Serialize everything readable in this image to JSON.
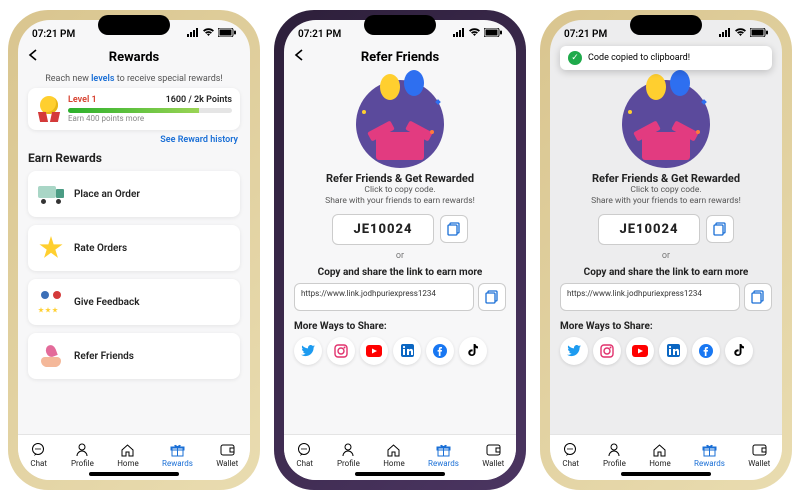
{
  "status": {
    "time": "07:21 PM"
  },
  "tabs": {
    "chat": "Chat",
    "profile": "Profile",
    "home": "Home",
    "rewards": "Rewards",
    "wallet": "Wallet"
  },
  "rewards_screen": {
    "title": "Rewards",
    "banner_prefix": "Reach new ",
    "banner_highlight": "levels",
    "banner_suffix": " to receive special rewards!",
    "level_name": "Level 1",
    "points_text": "1600 / 2k Points",
    "improve": "Earn 400 points more",
    "history_link": "See Reward history",
    "earn_heading": "Earn Rewards",
    "items": [
      {
        "label": "Place an Order"
      },
      {
        "label": "Rate Orders"
      },
      {
        "label": "Give Feedback"
      },
      {
        "label": "Refer Friends"
      }
    ]
  },
  "refer_screen": {
    "title": "Refer Friends",
    "heading": "Refer Friends & Get Rewarded",
    "sub1": "Click to copy code.",
    "sub2": "Share with your friends to earn rewards!",
    "code": "JE10024",
    "or": "or",
    "share_heading": "Copy and share the link to earn more",
    "url": "https://www.link.jodhpuriexpress1234",
    "more": "More Ways to Share:",
    "toast": "Code copied to clipboard!",
    "socials": [
      "twitter",
      "instagram",
      "youtube",
      "linkedin",
      "facebook",
      "tiktok"
    ]
  },
  "colors": {
    "accent": "#1a6fd6"
  }
}
